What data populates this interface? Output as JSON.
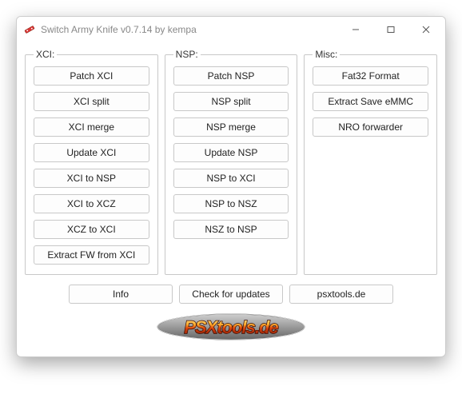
{
  "window": {
    "title": "Switch Army Knife v0.7.14 by kempa"
  },
  "groups": {
    "xci": {
      "legend": "XCI:",
      "buttons": [
        "Patch XCI",
        "XCI split",
        "XCI merge",
        "Update XCI",
        "XCI to NSP",
        "XCI to XCZ",
        "XCZ to XCI",
        "Extract FW from XCI"
      ]
    },
    "nsp": {
      "legend": "NSP:",
      "buttons": [
        "Patch NSP",
        "NSP split",
        "NSP merge",
        "Update NSP",
        "NSP to XCI",
        "NSP to NSZ",
        "NSZ to NSP"
      ]
    },
    "misc": {
      "legend": "Misc:",
      "buttons": [
        "Fat32 Format",
        "Extract Save eMMC",
        "NRO forwarder"
      ]
    }
  },
  "footer": {
    "info": "Info",
    "check": "Check for updates",
    "site": "psxtools.de"
  },
  "logo_text": "PSXtools.de"
}
